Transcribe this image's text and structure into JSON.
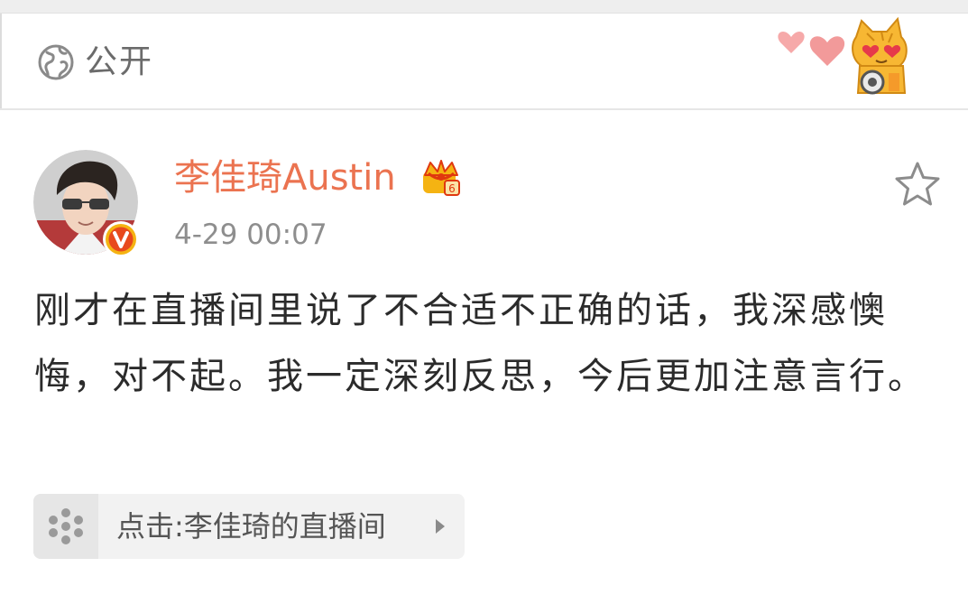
{
  "visibility": {
    "icon": "globe-icon",
    "label": "公开"
  },
  "sticker": {
    "icon": "heart-eyes-cat-sticker"
  },
  "post": {
    "author": {
      "name": "李佳琦Austin",
      "avatar_icon": "avatar",
      "verified_icon": "verified-v-badge",
      "membership_icon": "crown-icon"
    },
    "timestamp": "4-29 00:07",
    "favorite_icon": "star-icon",
    "text": "刚才在直播间里说了不合适不正确的话，我深感懊悔，对不起。我一定深刻反思，今后更加注意言行。",
    "link_card": {
      "icon": "live-broadcast-icon",
      "label": "点击:李佳琦的直播间",
      "arrow_icon": "chevron-right-icon"
    }
  },
  "colors": {
    "username": "#eb7350",
    "timestamp": "#8e8e8e",
    "body_text": "#2b2b2b",
    "card_bg": "#f2f2f2",
    "badge_orange": "#ee5a1e",
    "crown_gold": "#f5b312"
  }
}
